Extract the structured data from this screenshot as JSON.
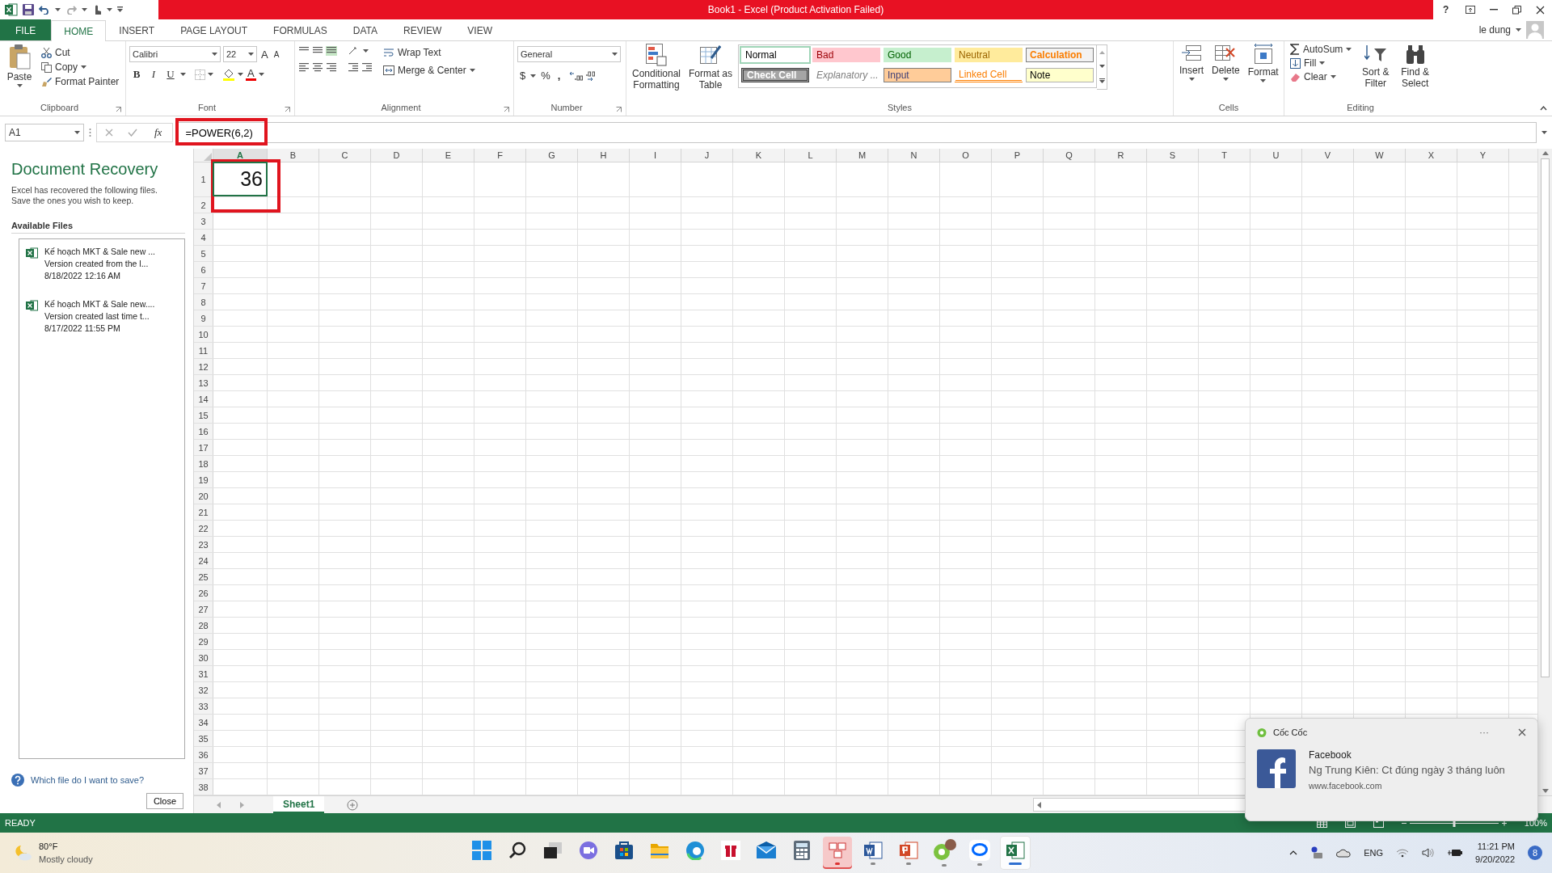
{
  "window": {
    "title": "Book1 -  Excel (Product Activation Failed)",
    "help": "?",
    "user": "le dung"
  },
  "ribbon_tabs": [
    {
      "label": "FILE",
      "kind": "file",
      "selected": false
    },
    {
      "label": "HOME",
      "kind": "tab",
      "selected": true
    },
    {
      "label": "INSERT",
      "kind": "tab",
      "selected": false
    },
    {
      "label": "PAGE LAYOUT",
      "kind": "tab",
      "selected": false
    },
    {
      "label": "FORMULAS",
      "kind": "tab",
      "selected": false
    },
    {
      "label": "DATA",
      "kind": "tab",
      "selected": false
    },
    {
      "label": "REVIEW",
      "kind": "tab",
      "selected": false
    },
    {
      "label": "VIEW",
      "kind": "tab",
      "selected": false
    }
  ],
  "clipboard": {
    "paste": "Paste",
    "cut": "Cut",
    "copy": "Copy",
    "format_painter": "Format Painter",
    "label": "Clipboard"
  },
  "font": {
    "name": "Calibri",
    "size": "22",
    "grow": "A",
    "shrink": "A",
    "bold": "B",
    "italic": "I",
    "underline": "U",
    "font_color": "A",
    "label": "Font"
  },
  "alignment": {
    "wrap_text": "Wrap Text",
    "merge_center": "Merge & Center",
    "label": "Alignment"
  },
  "number": {
    "format": "General",
    "currency": "$",
    "percent": "%",
    "comma": ",",
    "label": "Number"
  },
  "styles": {
    "conditional_formatting": "Conditional Formatting",
    "format_as_table": "Format as Table",
    "label": "Styles",
    "cell_styles": [
      {
        "label": "Normal",
        "kind": "normal",
        "color": "#ffffff",
        "selected": true
      },
      {
        "label": "Bad",
        "kind": "bad",
        "color": "#ffc7ce",
        "selected": false
      },
      {
        "label": "Good",
        "kind": "good",
        "color": "#c6efce",
        "selected": false
      },
      {
        "label": "Neutral",
        "kind": "neutral",
        "color": "#ffeb9c",
        "selected": false
      },
      {
        "label": "Calculation",
        "kind": "calculation",
        "color": "#f2f2f2",
        "selected": false
      },
      {
        "label": "Check Cell",
        "kind": "check",
        "color": "#a5a5a5",
        "selected": false
      },
      {
        "label": "Explanatory ...",
        "kind": "explanatory",
        "color": "#ffffff",
        "selected": false
      },
      {
        "label": "Input",
        "kind": "input",
        "color": "#ffcc99",
        "selected": false
      },
      {
        "label": "Linked Cell",
        "kind": "linked",
        "color": "#ffffff",
        "selected": false
      },
      {
        "label": "Note",
        "kind": "note",
        "color": "#ffffcc",
        "selected": false
      }
    ]
  },
  "cells": {
    "insert": "Insert",
    "delete": "Delete",
    "format": "Format",
    "label": "Cells"
  },
  "editing": {
    "autosum": "AutoSum",
    "fill": "Fill",
    "clear": "Clear",
    "sort_filter": "Sort & Filter",
    "find_select": "Find & Select",
    "label": "Editing"
  },
  "formula_bar": {
    "name_box": "A1",
    "fx": "fx",
    "formula": "=POWER(6,2)",
    "highlighted": true
  },
  "recovery": {
    "title": "Document Recovery",
    "description": "Excel has recovered the following files. Save the ones you wish to keep.",
    "section": "Available Files",
    "files": [
      {
        "name": "Kế hoạch MKT & Sale new ...",
        "version": "Version created from the l...",
        "date": "8/18/2022 12:16 AM"
      },
      {
        "name": "Kế hoạch MKT & Sale new....",
        "version": "Version created last time t...",
        "date": "8/17/2022 11:55 PM"
      }
    ],
    "help_link": "Which file do I want to save?",
    "close": "Close"
  },
  "sheet": {
    "columns": [
      {
        "label": "A",
        "selected": true
      },
      {
        "label": "B",
        "selected": false
      },
      {
        "label": "C",
        "selected": false
      },
      {
        "label": "D",
        "selected": false
      },
      {
        "label": "E",
        "selected": false
      },
      {
        "label": "F",
        "selected": false
      },
      {
        "label": "G",
        "selected": false
      },
      {
        "label": "H",
        "selected": false
      },
      {
        "label": "I",
        "selected": false
      },
      {
        "label": "J",
        "selected": false
      },
      {
        "label": "K",
        "selected": false
      },
      {
        "label": "L",
        "selected": false
      },
      {
        "label": "M",
        "selected": false
      },
      {
        "label": "N",
        "selected": false
      },
      {
        "label": "O",
        "selected": false
      },
      {
        "label": "P",
        "selected": false
      },
      {
        "label": "Q",
        "selected": false
      },
      {
        "label": "R",
        "selected": false
      },
      {
        "label": "S",
        "selected": false
      },
      {
        "label": "T",
        "selected": false
      },
      {
        "label": "U",
        "selected": false
      },
      {
        "label": "V",
        "selected": false
      },
      {
        "label": "W",
        "selected": false
      },
      {
        "label": "X",
        "selected": false
      },
      {
        "label": "Y",
        "selected": false
      }
    ],
    "rows": [
      "1",
      "2",
      "3",
      "4",
      "5",
      "6",
      "7",
      "8",
      "9",
      "10",
      "11",
      "12",
      "13",
      "14",
      "15",
      "16",
      "17",
      "18",
      "19",
      "20",
      "21",
      "22",
      "23",
      "24",
      "25",
      "26",
      "27",
      "28",
      "29",
      "30",
      "31",
      "32",
      "33",
      "34",
      "35",
      "36",
      "37",
      "38"
    ],
    "active_cell": {
      "value": "36",
      "highlighted": true
    }
  },
  "sheet_tabs": [
    {
      "label": "Sheet1",
      "selected": true
    }
  ],
  "status_bar": {
    "status": "READY",
    "zoom": "100%",
    "level": 0.5
  },
  "notification": {
    "app": "Cốc Cốc",
    "more": "···",
    "title": "Facebook",
    "message": "Ng Trung Kiên: Ct đúng ngày 3 tháng luôn",
    "source": "www.facebook.com"
  },
  "taskbar": {
    "weather": {
      "temperature": "80°F",
      "condition": "Mostly cloudy"
    },
    "apps": [
      {
        "kind": "start",
        "running": false,
        "flagged": false,
        "selected": false
      },
      {
        "kind": "search",
        "running": false,
        "flagged": false,
        "selected": false
      },
      {
        "kind": "taskview",
        "running": false,
        "flagged": false,
        "selected": false
      },
      {
        "kind": "chat",
        "running": false,
        "flagged": false,
        "selected": false
      },
      {
        "kind": "store",
        "running": false,
        "flagged": false,
        "selected": false
      },
      {
        "kind": "folder",
        "running": false,
        "flagged": false,
        "selected": false
      },
      {
        "kind": "browser",
        "running": false,
        "flagged": false,
        "selected": false
      },
      {
        "kind": "gift",
        "running": false,
        "flagged": false,
        "selected": false
      },
      {
        "kind": "mail",
        "running": false,
        "flagged": false,
        "selected": false
      },
      {
        "kind": "calculator",
        "running": false,
        "flagged": false,
        "selected": false
      },
      {
        "kind": "keyboard",
        "running": true,
        "flagged": true,
        "selected": false
      },
      {
        "kind": "word",
        "running": true,
        "flagged": false,
        "selected": false
      },
      {
        "kind": "powerpoint",
        "running": true,
        "flagged": false,
        "selected": false
      },
      {
        "kind": "coccoc",
        "running": true,
        "flagged": false,
        "selected": false
      },
      {
        "kind": "chatbubble",
        "running": true,
        "flagged": false,
        "selected": false
      },
      {
        "kind": "excel",
        "running": true,
        "flagged": false,
        "selected": true
      }
    ],
    "tray": {
      "language": "ENG",
      "time": "11:21 PM",
      "date": "9/20/2022",
      "badge": "8"
    }
  }
}
